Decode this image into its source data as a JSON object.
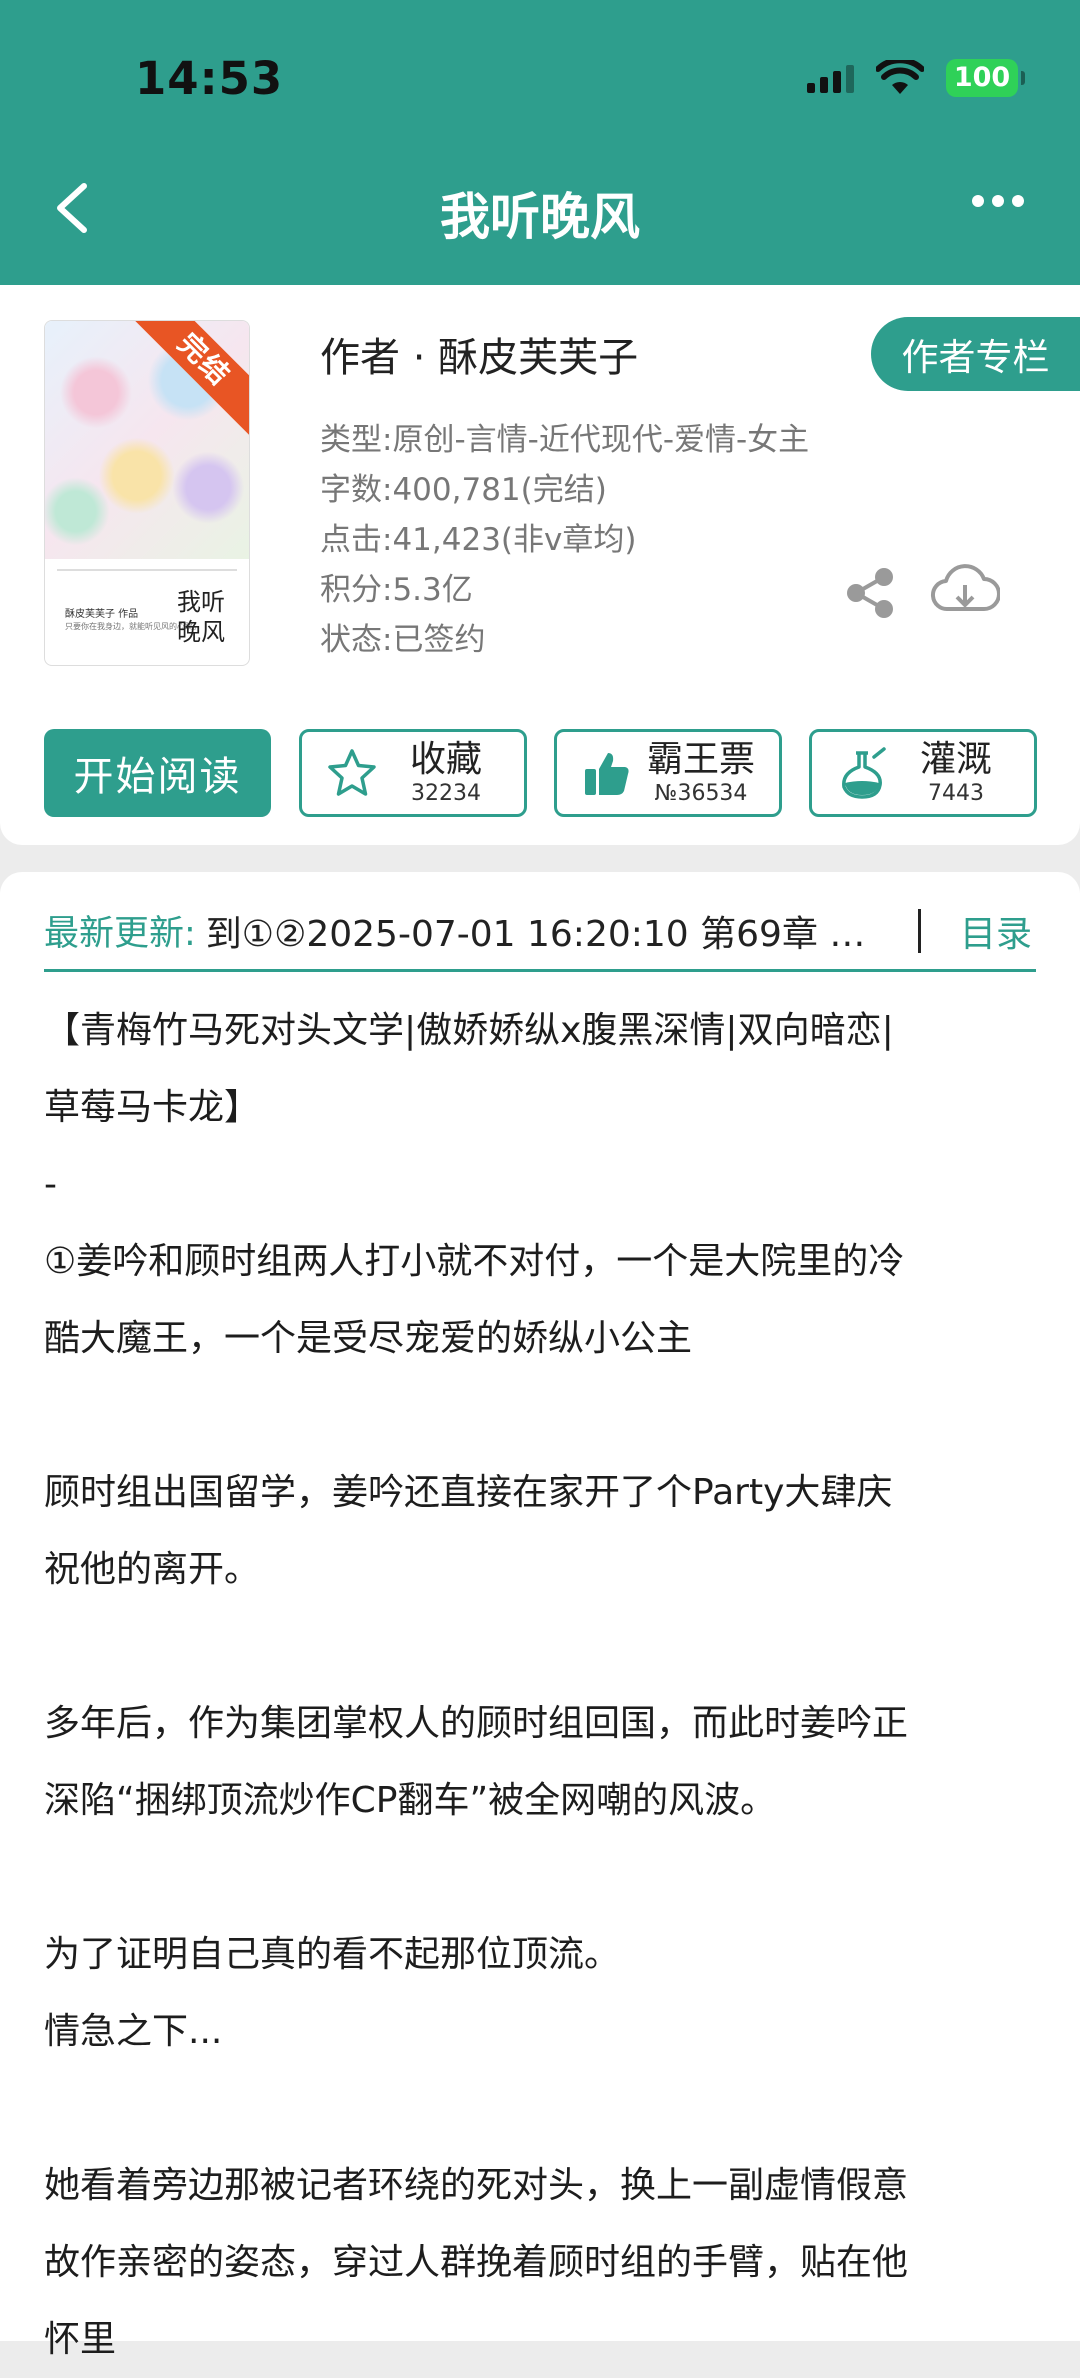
{
  "status": {
    "time": "14:53",
    "battery": "100"
  },
  "nav": {
    "title": "我听晚风"
  },
  "book": {
    "cover_badge": "完结",
    "cover_author_text": "酥皮芙芙子 作品",
    "cover_sub_text": "只要你在我身边，就能听见风的心跳。",
    "cover_title": "我听晚风",
    "author": "作者 · 酥皮芙芙子",
    "author_column_label": "作者专栏",
    "meta": {
      "genre": "类型:原创-言情-近代现代-爱情-女主",
      "word_count": "字数:400,781(完结)",
      "clicks": "点击:41,423(非v章均)",
      "score": "积分:5.3亿",
      "state": "状态:已签约"
    }
  },
  "actions": {
    "read_label": "开始阅读",
    "favorite": {
      "label": "收藏",
      "count": "32234"
    },
    "vote": {
      "label": "霸王票",
      "count": "№36534"
    },
    "nourish": {
      "label": "灌溉",
      "count": "7443"
    }
  },
  "update": {
    "label": "最新更新:",
    "text": "到①②2025-07-01 16:20:10   第69章 …",
    "toc_label": "目录"
  },
  "synopsis": "【青梅竹马死对头文学|傲娇娇纵x腹黑深情|双向暗恋|\n草莓马卡龙】\n-\n①姜吟和顾时组两人打小就不对付，一个是大院里的冷\n酷大魔王，一个是受尽宠爱的娇纵小公主\n\n顾时组出国留学，姜吟还直接在家开了个Party大肆庆\n祝他的离开。\n\n多年后，作为集团掌权人的顾时组回国，而此时姜吟正\n深陷“捆绑顶流炒作CP翻车”被全网嘲的风波。\n\n为了证明自己真的看不起那位顶流。\n情急之下...\n\n她看着旁边那被记者环绕的死对头，换上一副虚情假意\n故作亲密的姿态，穿过人群挽着顾时组的手臂，贴在他\n怀里"
}
